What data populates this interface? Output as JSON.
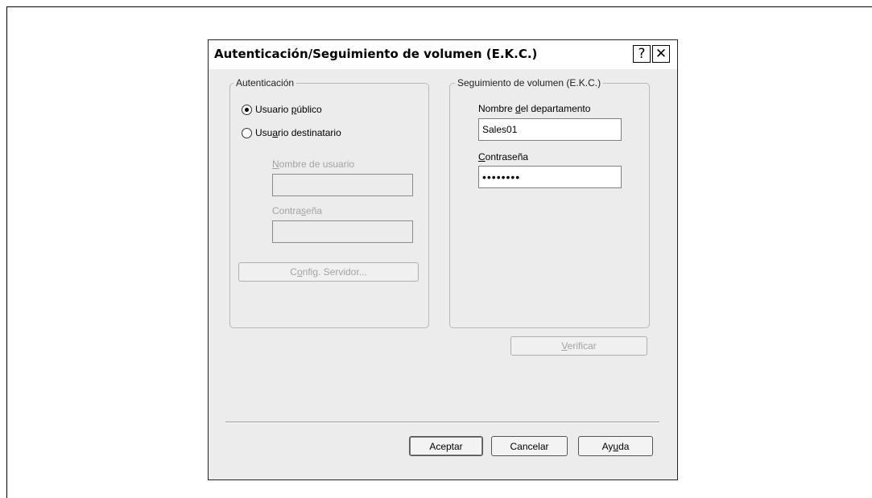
{
  "dialog": {
    "title": "Autenticación/Seguimiento de volumen (E.K.C.)",
    "help_glyph": "?",
    "close_glyph": "✕"
  },
  "auth_group": {
    "legend": "Autenticación",
    "radio_public": {
      "label_pre": "Usuario ",
      "label_u": "p",
      "label_post": "úblico",
      "checked": true
    },
    "radio_recipient": {
      "label_pre": "Usu",
      "label_u": "a",
      "label_post": "rio destinatario",
      "checked": false
    },
    "username_label": {
      "pre": "",
      "u": "N",
      "post": "ombre de usuario"
    },
    "username_value": "",
    "password_label": {
      "pre": "Contra",
      "u": "s",
      "post": "eña"
    },
    "password_value": "",
    "server_button": {
      "pre": "C",
      "u": "o",
      "post": "nfig. Servidor..."
    }
  },
  "ekc_group": {
    "legend": "Seguimiento de volumen (E.K.C.)",
    "dept_label": {
      "pre": "Nombre ",
      "u": "d",
      "post": "el departamento"
    },
    "dept_value": "Sales01",
    "password_label": {
      "pre": "",
      "u": "C",
      "post": "ontraseña"
    },
    "password_value": "••••••••"
  },
  "verify_button": {
    "pre": "",
    "u": "V",
    "post": "erificar"
  },
  "footer": {
    "ok": "Aceptar",
    "cancel": "Cancelar",
    "help": {
      "pre": "Ay",
      "u": "u",
      "post": "da"
    }
  }
}
